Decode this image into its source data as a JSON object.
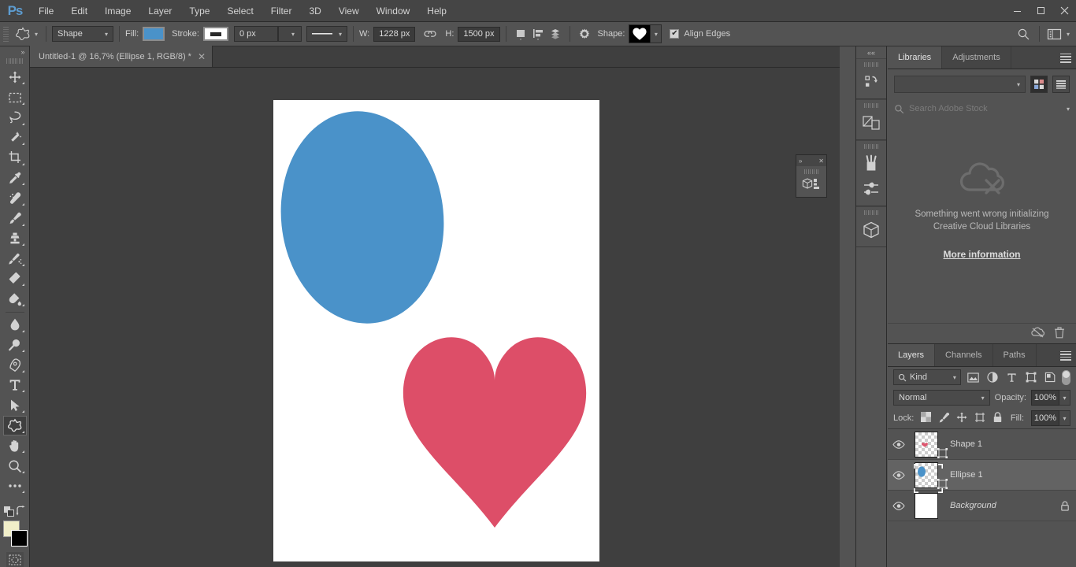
{
  "app": {
    "name": "Adobe Photoshop",
    "logo": "Ps"
  },
  "menubar": {
    "items": [
      "File",
      "Edit",
      "Image",
      "Layer",
      "Type",
      "Select",
      "Filter",
      "3D",
      "View",
      "Window",
      "Help"
    ],
    "window_controls": {
      "minimize": "–",
      "maximize": "□",
      "close": "✕"
    }
  },
  "options_bar": {
    "tool_icon": "custom-shape-tool-icon",
    "mode_value": "Shape",
    "fill_label": "Fill:",
    "fill_color": "#4a92c9",
    "stroke_label": "Stroke:",
    "stroke_color": "#2a2a2a",
    "stroke_width": "0 px",
    "stroke_style": "solid-line",
    "width_label": "W:",
    "width_value": "1228 px",
    "link_icon": "link-chain-icon",
    "height_label": "H:",
    "height_value": "1500 px",
    "path_op_icon": "path-operations-icon",
    "path_align_icon": "path-alignment-icon",
    "path_arrange_icon": "path-arrangement-icon",
    "settings_icon": "gear-icon",
    "shape_label": "Shape:",
    "shape_preview": "heart-shape-swatch",
    "align_edges_label": "Align Edges",
    "align_edges_checked": true,
    "search_icon": "search-icon",
    "workspace_icon": "workspace-switcher-icon"
  },
  "document_tab": {
    "title": "Untitled-1 @ 16,7% (Ellipse 1, RGB/8) *",
    "close": "✕"
  },
  "toolbar": {
    "collapse": "»",
    "groups": [
      [
        {
          "name": "move-tool",
          "icon": "move-tool-icon"
        },
        {
          "name": "rectangular-marquee-tool",
          "icon": "marquee-tool-icon"
        },
        {
          "name": "lasso-tool",
          "icon": "lasso-tool-icon"
        },
        {
          "name": "magic-wand-tool",
          "icon": "magic-wand-tool-icon"
        },
        {
          "name": "crop-tool",
          "icon": "crop-tool-icon"
        },
        {
          "name": "eyedropper-tool",
          "icon": "eyedropper-tool-icon"
        },
        {
          "name": "spot-healing-brush-tool",
          "icon": "healing-brush-tool-icon"
        },
        {
          "name": "brush-tool",
          "icon": "brush-tool-icon"
        },
        {
          "name": "clone-stamp-tool",
          "icon": "clone-stamp-tool-icon"
        },
        {
          "name": "history-brush-tool",
          "icon": "history-brush-tool-icon"
        },
        {
          "name": "eraser-tool",
          "icon": "eraser-tool-icon"
        },
        {
          "name": "gradient-tool",
          "icon": "paint-bucket-tool-icon"
        },
        {
          "name": "blur-tool",
          "icon": "blur-tool-icon"
        },
        {
          "name": "dodge-tool",
          "icon": "dodge-tool-icon"
        },
        {
          "name": "pen-tool",
          "icon": "pen-tool-icon"
        },
        {
          "name": "horizontal-type-tool",
          "icon": "type-tool-icon"
        },
        {
          "name": "path-selection-tool",
          "icon": "path-selection-tool-icon"
        },
        {
          "name": "custom-shape-tool",
          "icon": "custom-shape-tool-icon",
          "selected": true
        },
        {
          "name": "hand-tool",
          "icon": "hand-tool-icon"
        },
        {
          "name": "zoom-tool",
          "icon": "zoom-tool-icon"
        },
        {
          "name": "edit-toolbar",
          "icon": "more-tools-icon"
        }
      ]
    ],
    "foreground_color": "#f1efc9",
    "background_color": "#000000",
    "quick_mask": "quick-mask-icon"
  },
  "canvas": {
    "background": "#3f3f3f",
    "document_background": "#ffffff",
    "shapes": [
      {
        "name": "ellipse-shape",
        "type": "ellipse",
        "fill": "#4a92c9",
        "cx": "27%",
        "cy": "23%"
      },
      {
        "name": "heart-shape",
        "type": "heart",
        "fill": "#dd4e68",
        "cx": "68%",
        "cy": "70%"
      }
    ]
  },
  "icon_dock": {
    "collapse": "««",
    "buttons": [
      {
        "name": "history-panel-icon",
        "label": "history-icon"
      },
      {
        "name": "layer-comps-panel-icon",
        "label": "layer-comps-icon"
      },
      {
        "name": "brushes-panel-icon",
        "label": "brushes-icon"
      },
      {
        "name": "brush-settings-panel-icon",
        "label": "brush-settings-icon"
      },
      {
        "name": "3d-panel-icon",
        "label": "3d-cube-icon"
      }
    ]
  },
  "mini_panel": {
    "expand": "»",
    "close": "✕",
    "icon": "3d-panel-icon"
  },
  "libraries_panel": {
    "tabs": [
      {
        "label": "Libraries",
        "active": true
      },
      {
        "label": "Adjustments",
        "active": false
      }
    ],
    "menu_icon": "panel-menu-icon",
    "library_select_value": "",
    "view_grid_icon": "grid-view-icon",
    "view_list_icon": "list-view-icon",
    "search_icon": "search-icon",
    "search_placeholder": "Search Adobe Stock",
    "error_icon": "cloud-error-icon",
    "error_line1": "Something went wrong initializing",
    "error_line2": "Creative Cloud Libraries",
    "more_info_link": "More information",
    "footer_sync_icon": "cloud-off-icon",
    "footer_delete_icon": "trash-icon"
  },
  "layers_panel": {
    "tabs": [
      {
        "label": "Layers",
        "active": true
      },
      {
        "label": "Channels",
        "active": false
      },
      {
        "label": "Paths",
        "active": false
      }
    ],
    "menu_icon": "panel-menu-icon",
    "filter": {
      "search_icon": "search-icon",
      "kind_label": "Kind",
      "icons": [
        "pixel-layer-filter-icon",
        "adjustment-layer-filter-icon",
        "type-layer-filter-icon",
        "shape-layer-filter-icon",
        "smart-object-filter-icon"
      ],
      "toggle": "filter-toggle"
    },
    "blend_mode": "Normal",
    "opacity_label": "Opacity:",
    "opacity_value": "100%",
    "lock_label": "Lock:",
    "lock_icons": [
      "lock-transparent-pixels-icon",
      "lock-image-pixels-icon",
      "lock-position-icon",
      "lock-artboard-icon",
      "lock-all-icon"
    ],
    "fill_label": "Fill:",
    "fill_value": "100%",
    "layers": [
      {
        "name": "Shape 1",
        "visible": true,
        "selected": false,
        "locked": false,
        "thumb": "shape-heart-thumb",
        "italic": false
      },
      {
        "name": "Ellipse 1",
        "visible": true,
        "selected": true,
        "locked": false,
        "thumb": "shape-ellipse-thumb",
        "italic": false
      },
      {
        "name": "Background",
        "visible": true,
        "selected": false,
        "locked": true,
        "thumb": "white-thumb",
        "italic": true
      }
    ]
  },
  "colors": {
    "chrome": "#535353",
    "panel_header": "#454545",
    "canvas_bg": "#3f3f3f",
    "accent_blue": "#4a92c9",
    "accent_red": "#dd4e68",
    "text": "#d0d0d0"
  }
}
